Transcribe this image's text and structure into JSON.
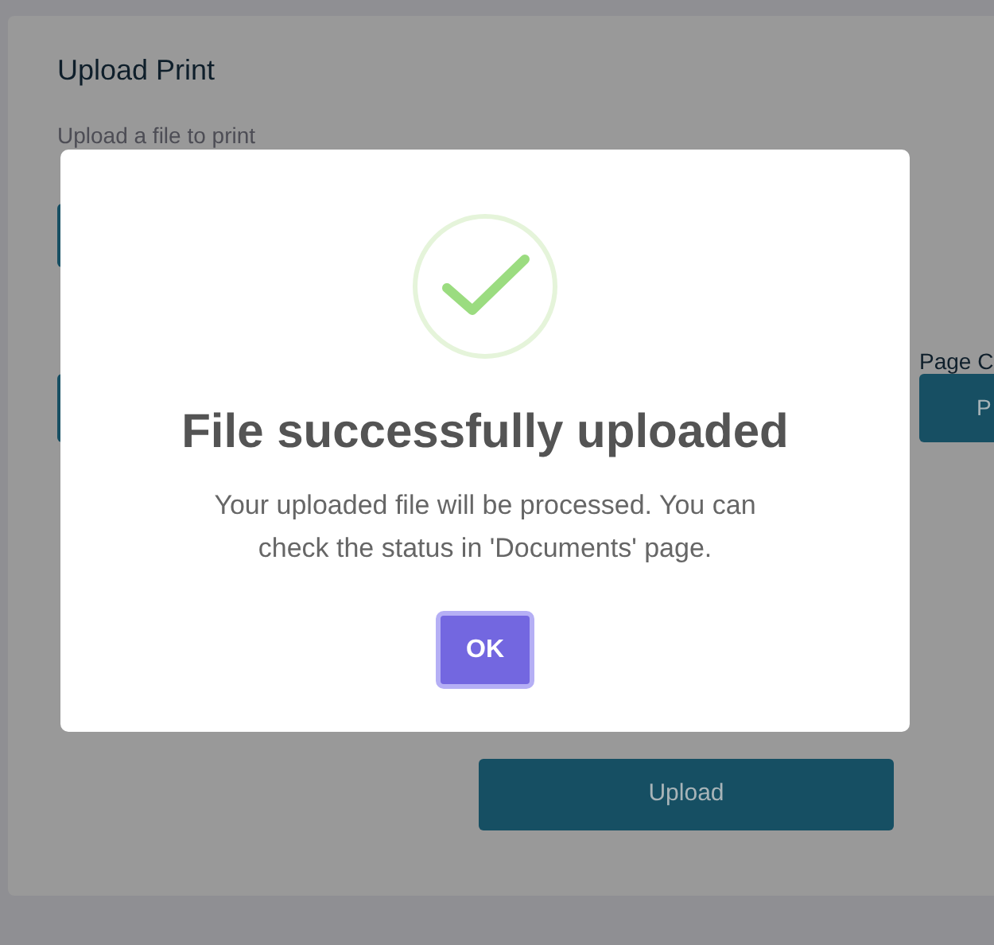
{
  "card": {
    "title": "Upload Print",
    "subtitle": "Upload a file to print",
    "page_label": "Page C",
    "page_button": "P",
    "submit_button": "Upload"
  },
  "dialog": {
    "kind": "success",
    "title": "File successfully uploaded",
    "message": "Your uploaded file will be processed. You can check the status in 'Documents' page.",
    "confirm_button": "OK"
  }
}
